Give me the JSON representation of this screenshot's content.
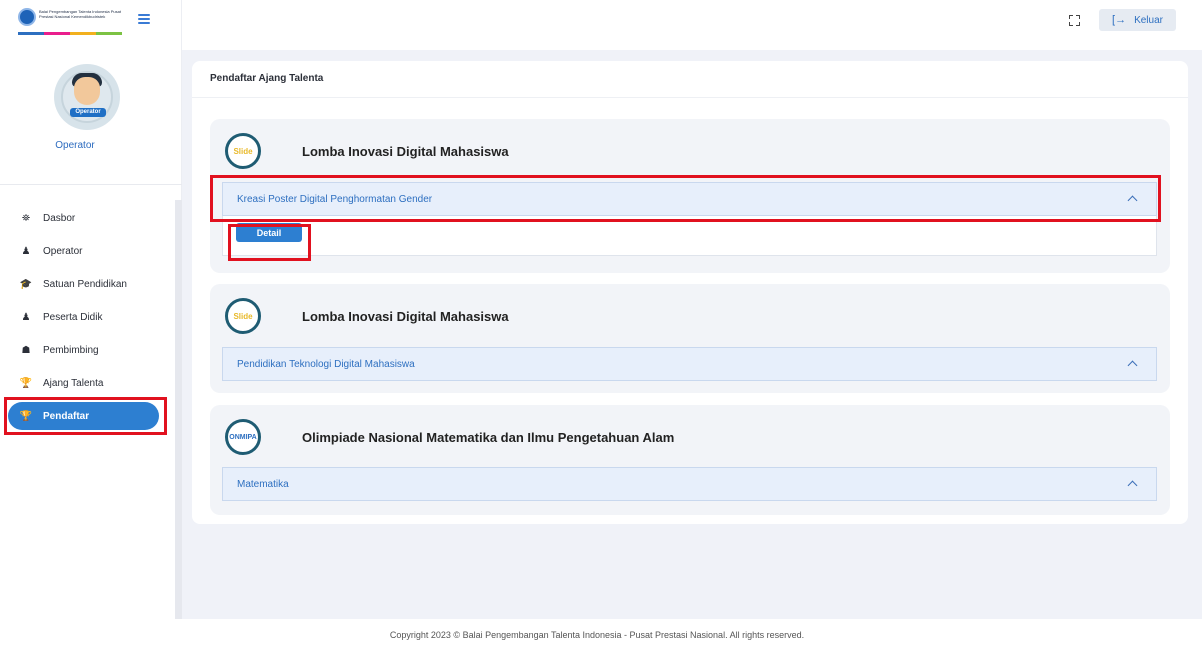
{
  "brand": {
    "logo_text": "Balai Pengembangan Talenta Indonesia Pusat Prestasi Nasional Kemendikbudristek",
    "stripe_colors": [
      "#2d6fc0",
      "#e91e8c",
      "#f2b01e",
      "#7cc243"
    ]
  },
  "user": {
    "name": "Operator",
    "avatar_badge": "Operator"
  },
  "sidebar": {
    "items": [
      {
        "label": "Dasbor",
        "icon": "⛯"
      },
      {
        "label": "Operator",
        "icon": "♟"
      },
      {
        "label": "Satuan Pendidikan",
        "icon": "🎓"
      },
      {
        "label": "Peserta Didik",
        "icon": "♟"
      },
      {
        "label": "Pembimbing",
        "icon": "☗"
      },
      {
        "label": "Ajang Talenta",
        "icon": "🏆"
      },
      {
        "label": "Pendaftar",
        "icon": "🏆",
        "active": true
      }
    ]
  },
  "topbar": {
    "logout_label": "Keluar",
    "logout_icon": "[→"
  },
  "page": {
    "title": "Pendaftar Ajang Talenta",
    "competitions": [
      {
        "logo": "Slide",
        "title": "Lomba Inovasi Digital Mahasiswa",
        "category": "Kreasi Poster Digital Penghormatan Gender",
        "detail_label": "Detail"
      },
      {
        "logo": "Slide",
        "title": "Lomba Inovasi Digital Mahasiswa",
        "category": "Pendidikan Teknologi Digital Mahasiswa"
      },
      {
        "logo": "ONMIPA",
        "title": "Olimpiade Nasional Matematika dan Ilmu Pengetahuan Alam",
        "category": "Matematika"
      }
    ]
  },
  "footer": {
    "copyright": "Copyright 2023 © Balai Pengembangan Talenta Indonesia - Pusat Prestasi Nasional. All rights reserved."
  },
  "colors": {
    "accent": "#2d7fd1",
    "highlight_box": "#e1111f"
  }
}
